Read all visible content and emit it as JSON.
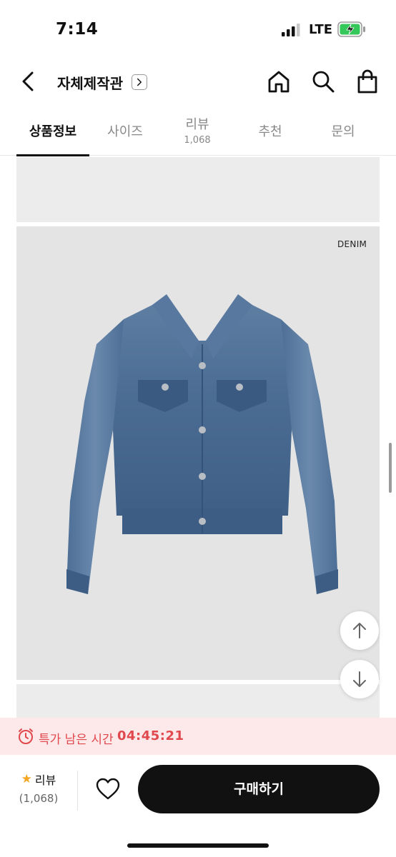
{
  "status": {
    "time": "7:14",
    "network": "LTE",
    "battery_color": "#34c759"
  },
  "header": {
    "title": "자체제작관",
    "icons": [
      "back-icon",
      "home-icon",
      "search-icon",
      "shopping-bag-icon"
    ]
  },
  "tabs": [
    {
      "label": "상품정보",
      "active": true
    },
    {
      "label": "사이즈"
    },
    {
      "label": "리뷰",
      "sub": "1,068"
    },
    {
      "label": "추천"
    },
    {
      "label": "문의"
    }
  ],
  "content": {
    "image_label": "DENIM"
  },
  "sale": {
    "text": "특가 남은 시간",
    "timer": "04:45:21",
    "accent": "#e0484d"
  },
  "bottom": {
    "review_label": "리뷰",
    "review_count": "(1,068)",
    "buy_label": "구매하기",
    "star_color": "#f5a623"
  }
}
